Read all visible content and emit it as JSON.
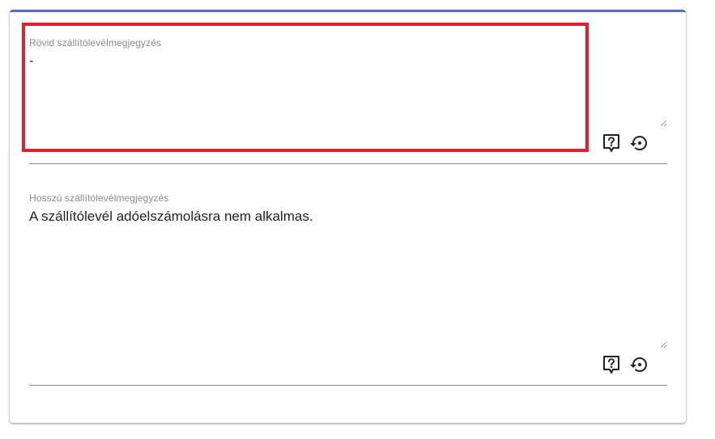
{
  "form": {
    "short_note": {
      "label": "Rövid szállítólevélmegjegyzés",
      "value": "-"
    },
    "long_note": {
      "label": "Hosszú szállítólevélmegjegyzés",
      "value": "A szállítólevél adóelszámolásra nem alkalmas."
    }
  },
  "icons": {
    "help": "help-icon",
    "reset": "reset-icon",
    "resize": "resize-handle-icon"
  },
  "colors": {
    "card_accent": "#5c6bc0",
    "highlight": "#e41e2c",
    "label": "#8a8a8a",
    "text": "#222222",
    "underline": "#8d8d8d"
  }
}
